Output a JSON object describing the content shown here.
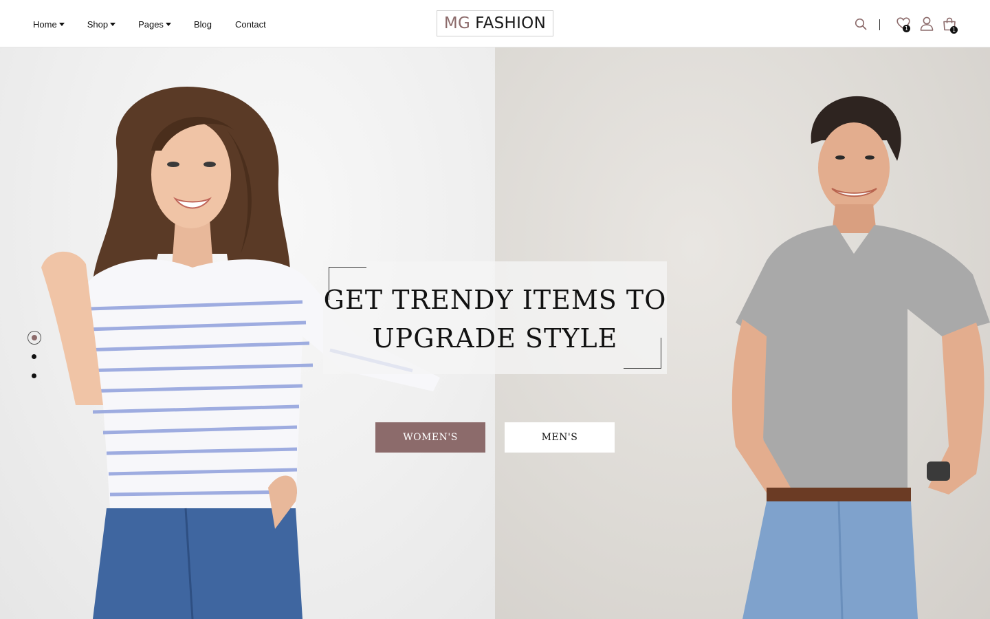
{
  "header": {
    "nav": [
      {
        "label": "Home",
        "has_dropdown": true
      },
      {
        "label": "Shop",
        "has_dropdown": true
      },
      {
        "label": "Pages",
        "has_dropdown": true
      },
      {
        "label": "Blog",
        "has_dropdown": false
      },
      {
        "label": "Contact",
        "has_dropdown": false
      }
    ],
    "logo": {
      "part1": "MG",
      "part2": "FASHION"
    },
    "icons": {
      "search": "search-icon",
      "wishlist": "heart-icon",
      "account": "user-icon",
      "cart": "shopping-bag-icon"
    },
    "wishlist_count": "1",
    "cart_count": "1"
  },
  "hero": {
    "headline_line1": "GET TRENDY ITEMS TO",
    "headline_line2": "UPGRADE STYLE",
    "buttons": {
      "women": "WOMEN'S",
      "men": "MEN'S"
    },
    "slides": {
      "count": 3,
      "active": 1
    }
  },
  "colors": {
    "accent": "#8c6b6b",
    "text": "#111111",
    "header_bg": "#ffffff",
    "left_panel_bg": "#efefef",
    "right_panel_bg": "#dcd9d4"
  }
}
